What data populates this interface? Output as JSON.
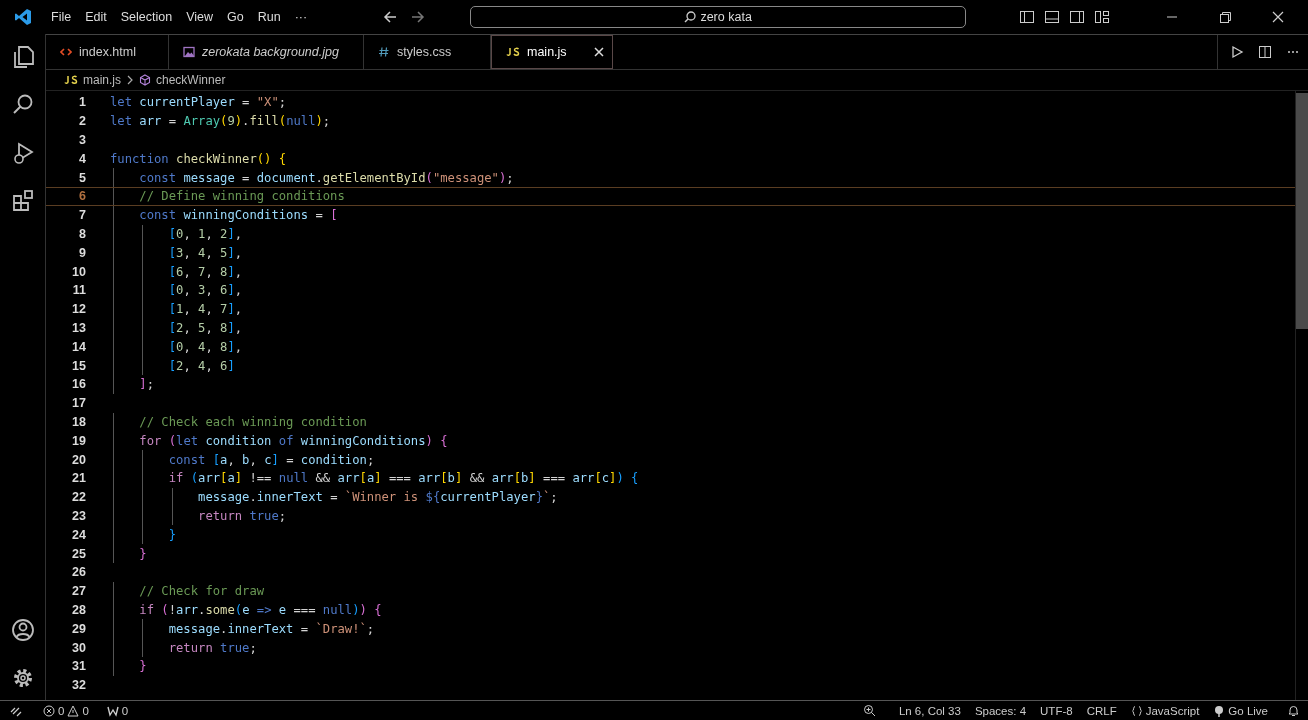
{
  "title_bar": {
    "menu": [
      "File",
      "Edit",
      "Selection",
      "View",
      "Go",
      "Run",
      "···"
    ],
    "search": {
      "value": "zero kata"
    }
  },
  "tabs": [
    {
      "label": "index.html",
      "kind": "html",
      "preview": false,
      "selected": false
    },
    {
      "label": "zerokata background.jpg",
      "kind": "image",
      "preview": true,
      "selected": false
    },
    {
      "label": "styles.css",
      "kind": "css",
      "preview": false,
      "selected": false
    },
    {
      "label": "main.js",
      "kind": "js",
      "preview": false,
      "selected": true
    }
  ],
  "breadcrumb": [
    {
      "label": "main.js",
      "kind": "js"
    },
    {
      "label": "checkWinner",
      "kind": "function"
    }
  ],
  "editor": {
    "lines": [
      {
        "number": "1",
        "current": false,
        "tokens": [
          {
            "kind": "kw",
            "text": "let"
          },
          {
            "kind": "var",
            "text": " currentPlayer"
          },
          {
            "kind": "op",
            "text": " = "
          },
          {
            "kind": "str",
            "text": "\"X\""
          },
          {
            "kind": "op",
            "text": ";"
          }
        ]
      },
      {
        "number": "2",
        "current": false,
        "tokens": [
          {
            "kind": "kw",
            "text": "let"
          },
          {
            "kind": "var",
            "text": " arr"
          },
          {
            "kind": "op",
            "text": " = "
          },
          {
            "kind": "cls",
            "text": "Array"
          },
          {
            "kind": "b1",
            "text": "("
          },
          {
            "kind": "num",
            "text": "9"
          },
          {
            "kind": "b1",
            "text": ")"
          },
          {
            "kind": "op",
            "text": "."
          },
          {
            "kind": "fn",
            "text": "fill"
          },
          {
            "kind": "b1",
            "text": "("
          },
          {
            "kind": "kw",
            "text": "null"
          },
          {
            "kind": "b1",
            "text": ")"
          },
          {
            "kind": "op",
            "text": ";"
          }
        ]
      },
      {
        "number": "3",
        "current": false
      },
      {
        "number": "4",
        "current": false,
        "tokens": [
          {
            "kind": "kw",
            "text": "function"
          },
          {
            "kind": "fn",
            "text": " checkWinner"
          },
          {
            "kind": "b1",
            "text": "()"
          },
          {
            "kind": "b1",
            "text": " {"
          }
        ]
      },
      {
        "number": "5",
        "current": false,
        "tokens": [
          {
            "kind": "kw",
            "text": "    const"
          },
          {
            "kind": "var",
            "text": " message"
          },
          {
            "kind": "op",
            "text": " = "
          },
          {
            "kind": "var",
            "text": "document"
          },
          {
            "kind": "op",
            "text": "."
          },
          {
            "kind": "fn",
            "text": "getElementById"
          },
          {
            "kind": "b2",
            "text": "("
          },
          {
            "kind": "str",
            "text": "\"message\""
          },
          {
            "kind": "b2",
            "text": ")"
          },
          {
            "kind": "op",
            "text": ";"
          }
        ]
      },
      {
        "number": "6",
        "current": true,
        "tokens": [
          {
            "kind": "com",
            "text": "    // Define winning conditions"
          }
        ]
      },
      {
        "number": "7",
        "current": false,
        "tokens": [
          {
            "kind": "kw",
            "text": "    const"
          },
          {
            "kind": "var",
            "text": " winningConditions"
          },
          {
            "kind": "op",
            "text": " = "
          },
          {
            "kind": "b2",
            "text": "["
          }
        ]
      },
      {
        "number": "8",
        "current": false,
        "tokens": [
          {
            "kind": "b3",
            "text": "        ["
          },
          {
            "kind": "num",
            "text": "0"
          },
          {
            "kind": "op",
            "text": ", "
          },
          {
            "kind": "num",
            "text": "1"
          },
          {
            "kind": "op",
            "text": ", "
          },
          {
            "kind": "num",
            "text": "2"
          },
          {
            "kind": "b3",
            "text": "]"
          },
          {
            "kind": "op",
            "text": ","
          }
        ]
      },
      {
        "number": "9",
        "current": false,
        "tokens": [
          {
            "kind": "b3",
            "text": "        ["
          },
          {
            "kind": "num",
            "text": "3"
          },
          {
            "kind": "op",
            "text": ", "
          },
          {
            "kind": "num",
            "text": "4"
          },
          {
            "kind": "op",
            "text": ", "
          },
          {
            "kind": "num",
            "text": "5"
          },
          {
            "kind": "b3",
            "text": "]"
          },
          {
            "kind": "op",
            "text": ","
          }
        ]
      },
      {
        "number": "10",
        "current": false,
        "tokens": [
          {
            "kind": "b3",
            "text": "        ["
          },
          {
            "kind": "num",
            "text": "6"
          },
          {
            "kind": "op",
            "text": ", "
          },
          {
            "kind": "num",
            "text": "7"
          },
          {
            "kind": "op",
            "text": ", "
          },
          {
            "kind": "num",
            "text": "8"
          },
          {
            "kind": "b3",
            "text": "]"
          },
          {
            "kind": "op",
            "text": ","
          }
        ]
      },
      {
        "number": "11",
        "current": false,
        "tokens": [
          {
            "kind": "b3",
            "text": "        ["
          },
          {
            "kind": "num",
            "text": "0"
          },
          {
            "kind": "op",
            "text": ", "
          },
          {
            "kind": "num",
            "text": "3"
          },
          {
            "kind": "op",
            "text": ", "
          },
          {
            "kind": "num",
            "text": "6"
          },
          {
            "kind": "b3",
            "text": "]"
          },
          {
            "kind": "op",
            "text": ","
          }
        ]
      },
      {
        "number": "12",
        "current": false,
        "tokens": [
          {
            "kind": "b3",
            "text": "        ["
          },
          {
            "kind": "num",
            "text": "1"
          },
          {
            "kind": "op",
            "text": ", "
          },
          {
            "kind": "num",
            "text": "4"
          },
          {
            "kind": "op",
            "text": ", "
          },
          {
            "kind": "num",
            "text": "7"
          },
          {
            "kind": "b3",
            "text": "]"
          },
          {
            "kind": "op",
            "text": ","
          }
        ]
      },
      {
        "number": "13",
        "current": false,
        "tokens": [
          {
            "kind": "b3",
            "text": "        ["
          },
          {
            "kind": "num",
            "text": "2"
          },
          {
            "kind": "op",
            "text": ", "
          },
          {
            "kind": "num",
            "text": "5"
          },
          {
            "kind": "op",
            "text": ", "
          },
          {
            "kind": "num",
            "text": "8"
          },
          {
            "kind": "b3",
            "text": "]"
          },
          {
            "kind": "op",
            "text": ","
          }
        ]
      },
      {
        "number": "14",
        "current": false,
        "tokens": [
          {
            "kind": "b3",
            "text": "        ["
          },
          {
            "kind": "num",
            "text": "0"
          },
          {
            "kind": "op",
            "text": ", "
          },
          {
            "kind": "num",
            "text": "4"
          },
          {
            "kind": "op",
            "text": ", "
          },
          {
            "kind": "num",
            "text": "8"
          },
          {
            "kind": "b3",
            "text": "]"
          },
          {
            "kind": "op",
            "text": ","
          }
        ]
      },
      {
        "number": "15",
        "current": false,
        "tokens": [
          {
            "kind": "b3",
            "text": "        ["
          },
          {
            "kind": "num",
            "text": "2"
          },
          {
            "kind": "op",
            "text": ", "
          },
          {
            "kind": "num",
            "text": "4"
          },
          {
            "kind": "op",
            "text": ", "
          },
          {
            "kind": "num",
            "text": "6"
          },
          {
            "kind": "b3",
            "text": "]"
          }
        ]
      },
      {
        "number": "16",
        "current": false,
        "tokens": [
          {
            "kind": "b2",
            "text": "    ]"
          },
          {
            "kind": "op",
            "text": ";"
          }
        ]
      },
      {
        "number": "17",
        "current": false
      },
      {
        "number": "18",
        "current": false,
        "tokens": [
          {
            "kind": "com",
            "text": "    // Check each winning condition"
          }
        ]
      },
      {
        "number": "19",
        "current": false,
        "tokens": [
          {
            "kind": "ctl",
            "text": "    for"
          },
          {
            "kind": "b2",
            "text": " ("
          },
          {
            "kind": "kw",
            "text": "let"
          },
          {
            "kind": "var",
            "text": " condition"
          },
          {
            "kind": "kw",
            "text": " of"
          },
          {
            "kind": "var",
            "text": " winningConditions"
          },
          {
            "kind": "b2",
            "text": ")"
          },
          {
            "kind": "b2",
            "text": " {"
          }
        ]
      },
      {
        "number": "20",
        "current": false,
        "tokens": [
          {
            "kind": "kw",
            "text": "        const"
          },
          {
            "kind": "b3",
            "text": " ["
          },
          {
            "kind": "var",
            "text": "a"
          },
          {
            "kind": "op",
            "text": ", "
          },
          {
            "kind": "var",
            "text": "b"
          },
          {
            "kind": "op",
            "text": ", "
          },
          {
            "kind": "var",
            "text": "c"
          },
          {
            "kind": "b3",
            "text": "]"
          },
          {
            "kind": "op",
            "text": " = "
          },
          {
            "kind": "var",
            "text": "condition"
          },
          {
            "kind": "op",
            "text": ";"
          }
        ]
      },
      {
        "number": "21",
        "current": false,
        "tokens": [
          {
            "kind": "ctl",
            "text": "        if"
          },
          {
            "kind": "b3",
            "text": " ("
          },
          {
            "kind": "var",
            "text": "arr"
          },
          {
            "kind": "b1",
            "text": "["
          },
          {
            "kind": "var",
            "text": "a"
          },
          {
            "kind": "b1",
            "text": "]"
          },
          {
            "kind": "op",
            "text": " !== "
          },
          {
            "kind": "kw",
            "text": "null"
          },
          {
            "kind": "op",
            "text": " && "
          },
          {
            "kind": "var",
            "text": "arr"
          },
          {
            "kind": "b1",
            "text": "["
          },
          {
            "kind": "var",
            "text": "a"
          },
          {
            "kind": "b1",
            "text": "]"
          },
          {
            "kind": "op",
            "text": " === "
          },
          {
            "kind": "var",
            "text": "arr"
          },
          {
            "kind": "b1",
            "text": "["
          },
          {
            "kind": "var",
            "text": "b"
          },
          {
            "kind": "b1",
            "text": "]"
          },
          {
            "kind": "op",
            "text": " && "
          },
          {
            "kind": "var",
            "text": "arr"
          },
          {
            "kind": "b1",
            "text": "["
          },
          {
            "kind": "var",
            "text": "b"
          },
          {
            "kind": "b1",
            "text": "]"
          },
          {
            "kind": "op",
            "text": " === "
          },
          {
            "kind": "var",
            "text": "arr"
          },
          {
            "kind": "b1",
            "text": "["
          },
          {
            "kind": "var",
            "text": "c"
          },
          {
            "kind": "b1",
            "text": "]"
          },
          {
            "kind": "b3",
            "text": ")"
          },
          {
            "kind": "b3",
            "text": " {"
          }
        ]
      },
      {
        "number": "22",
        "current": false,
        "tokens": [
          {
            "kind": "var",
            "text": "            message"
          },
          {
            "kind": "op",
            "text": "."
          },
          {
            "kind": "var",
            "text": "innerText"
          },
          {
            "kind": "op",
            "text": " = "
          },
          {
            "kind": "str",
            "text": "`Winner is "
          },
          {
            "kind": "kw",
            "text": "${"
          },
          {
            "kind": "var",
            "text": "currentPlayer"
          },
          {
            "kind": "kw",
            "text": "}"
          },
          {
            "kind": "str",
            "text": "`"
          },
          {
            "kind": "op",
            "text": ";"
          }
        ]
      },
      {
        "number": "23",
        "current": false,
        "tokens": [
          {
            "kind": "ctl",
            "text": "            return"
          },
          {
            "kind": "kw",
            "text": " true"
          },
          {
            "kind": "op",
            "text": ";"
          }
        ]
      },
      {
        "number": "24",
        "current": false,
        "tokens": [
          {
            "kind": "b3",
            "text": "        }"
          }
        ]
      },
      {
        "number": "25",
        "current": false,
        "tokens": [
          {
            "kind": "b2",
            "text": "    }"
          }
        ]
      },
      {
        "number": "26",
        "current": false
      },
      {
        "number": "27",
        "current": false,
        "tokens": [
          {
            "kind": "com",
            "text": "    // Check for draw"
          }
        ]
      },
      {
        "number": "28",
        "current": false,
        "tokens": [
          {
            "kind": "ctl",
            "text": "    if"
          },
          {
            "kind": "b2",
            "text": " ("
          },
          {
            "kind": "op",
            "text": "!"
          },
          {
            "kind": "var",
            "text": "arr"
          },
          {
            "kind": "op",
            "text": "."
          },
          {
            "kind": "fn",
            "text": "some"
          },
          {
            "kind": "b3",
            "text": "("
          },
          {
            "kind": "var",
            "text": "e"
          },
          {
            "kind": "kw",
            "text": " =>"
          },
          {
            "kind": "var",
            "text": " e"
          },
          {
            "kind": "op",
            "text": " === "
          },
          {
            "kind": "kw",
            "text": "null"
          },
          {
            "kind": "b3",
            "text": ")"
          },
          {
            "kind": "b2",
            "text": ")"
          },
          {
            "kind": "b2",
            "text": " {"
          }
        ]
      },
      {
        "number": "29",
        "current": false,
        "tokens": [
          {
            "kind": "var",
            "text": "        message"
          },
          {
            "kind": "op",
            "text": "."
          },
          {
            "kind": "var",
            "text": "innerText"
          },
          {
            "kind": "op",
            "text": " = "
          },
          {
            "kind": "str",
            "text": "`Draw!`"
          },
          {
            "kind": "op",
            "text": ";"
          }
        ]
      },
      {
        "number": "30",
        "current": false,
        "tokens": [
          {
            "kind": "ctl",
            "text": "        return"
          },
          {
            "kind": "kw",
            "text": " true"
          },
          {
            "kind": "op",
            "text": ";"
          }
        ]
      },
      {
        "number": "31",
        "current": false,
        "tokens": [
          {
            "kind": "b2",
            "text": "    }"
          }
        ]
      },
      {
        "number": "32",
        "current": false
      }
    ]
  },
  "status_bar": {
    "errors": "0",
    "warnings": "0",
    "ports": "0",
    "position": "Ln 6, Col 33",
    "indent": "Spaces: 4",
    "encoding": "UTF-8",
    "eol": "CRLF",
    "language": "JavaScript",
    "live": "Go Live"
  }
}
